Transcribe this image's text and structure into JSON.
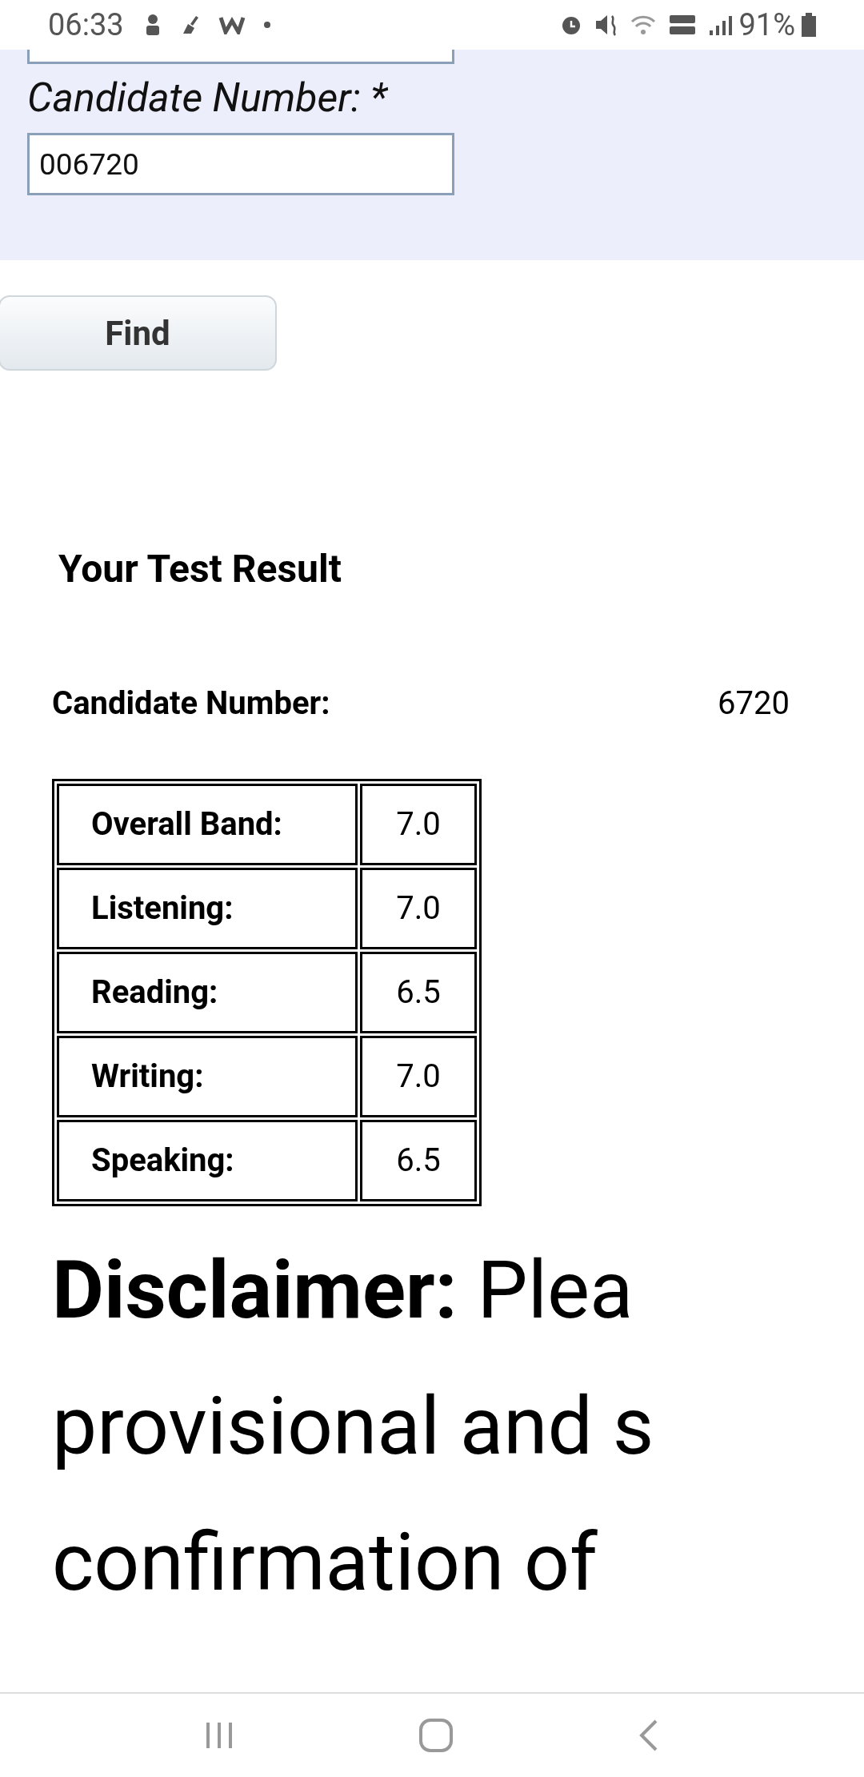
{
  "status_bar": {
    "time": "06:33",
    "battery": "91%"
  },
  "form": {
    "field_label": "Candidate Number: *",
    "field_value": "006720",
    "button": "Find"
  },
  "result": {
    "title": "Your Test Result",
    "candidate_label": "Candidate Number:",
    "candidate_value": "6720",
    "scores": [
      {
        "label": "Overall Band:",
        "value": "7.0"
      },
      {
        "label": "Listening:",
        "value": "7.0"
      },
      {
        "label": "Reading:",
        "value": "6.5"
      },
      {
        "label": "Writing:",
        "value": "7.0"
      },
      {
        "label": "Speaking:",
        "value": "6.5"
      }
    ]
  },
  "disclaimer": {
    "lines": [
      "**Disclaimer:** Plea",
      "provisional and s",
      "confirmation of"
    ]
  }
}
